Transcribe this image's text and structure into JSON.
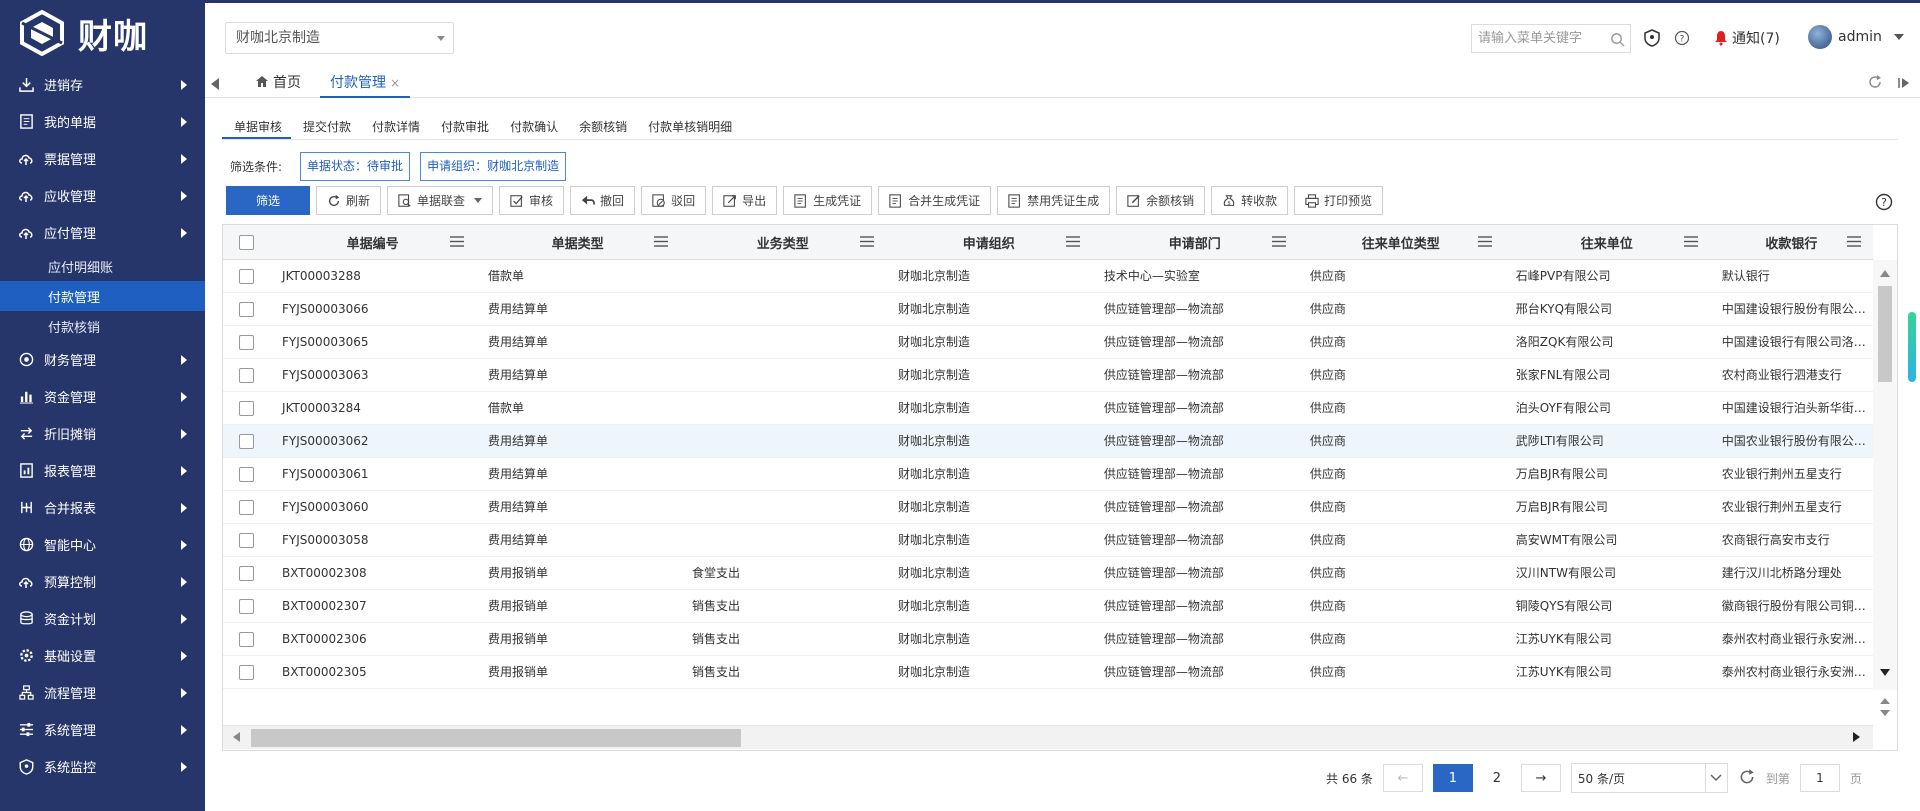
{
  "app": {
    "logo_text": "财咖",
    "org_selected": "财咖北京制造",
    "search_placeholder": "请输入菜单关键字",
    "notify_label": "通知(7)",
    "user_name": "admin"
  },
  "colors": {
    "sidebar": "#26366a",
    "accent": "#2a67c4",
    "active_sub": "#1f5fbf"
  },
  "sidebar": {
    "items": [
      {
        "label": "进销存",
        "icon": "download-icon"
      },
      {
        "label": "我的单据",
        "icon": "document-icon"
      },
      {
        "label": "票据管理",
        "icon": "cloud-upload-icon"
      },
      {
        "label": "应收管理",
        "icon": "cloud-upload-icon"
      },
      {
        "label": "应付管理",
        "icon": "cloud-upload-icon"
      },
      {
        "label": "财务管理",
        "icon": "finance-icon"
      },
      {
        "label": "资金管理",
        "icon": "bar-chart-icon"
      },
      {
        "label": "折旧摊销",
        "icon": "swap-icon"
      },
      {
        "label": "报表管理",
        "icon": "report-icon"
      },
      {
        "label": "合并报表",
        "icon": "merge-icon"
      },
      {
        "label": "智能中心",
        "icon": "globe-icon"
      },
      {
        "label": "预算控制",
        "icon": "cloud-upload-icon"
      },
      {
        "label": "资金计划",
        "icon": "database-icon"
      },
      {
        "label": "基础设置",
        "icon": "gear-icon"
      },
      {
        "label": "流程管理",
        "icon": "flow-icon"
      },
      {
        "label": "系统管理",
        "icon": "sliders-icon"
      },
      {
        "label": "系统监控",
        "icon": "shield-icon"
      }
    ],
    "subitems": [
      "应付明细账",
      "付款管理",
      "付款核销"
    ]
  },
  "tabs": {
    "home": "首页",
    "active": "付款管理",
    "close": "×"
  },
  "subtabs": [
    "单据审核",
    "提交付款",
    "付款详情",
    "付款审批",
    "付款确认",
    "余额核销",
    "付款单核销明细"
  ],
  "filters": {
    "label": "筛选条件:",
    "chips": [
      "单据状态：待审批",
      "申请组织：财咖北京制造"
    ]
  },
  "toolbar": {
    "filter": "筛选",
    "refresh": "刷新",
    "trace": "单据联查",
    "audit": "审核",
    "revoke": "撤回",
    "reject": "驳回",
    "export": "导出",
    "voucher": "生成凭证",
    "merge_voucher": "合并生成凭证",
    "disable_voucher": "禁用凭证生成",
    "balance_writeoff": "余额核销",
    "transfer": "转收款",
    "print_preview": "打印预览"
  },
  "table": {
    "columns": [
      "单据编号",
      "单据类型",
      "业务类型",
      "申请组织",
      "申请部门",
      "往来单位类型",
      "往来单位",
      "收款银行"
    ],
    "rows": [
      [
        "JKT00003288",
        "借款单",
        "",
        "财咖北京制造",
        "技术中心—实验室",
        "供应商",
        "石峰PVP有限公司",
        "默认银行"
      ],
      [
        "FYJS00003066",
        "费用结算单",
        "",
        "财咖北京制造",
        "供应链管理部—物流部",
        "供应商",
        "邢台KYQ有限公司",
        "中国建设银行股份有限公司..."
      ],
      [
        "FYJS00003065",
        "费用结算单",
        "",
        "财咖北京制造",
        "供应链管理部—物流部",
        "供应商",
        "洛阳ZQK有限公司",
        "中国建设银行有限公司洛阳..."
      ],
      [
        "FYJS00003063",
        "费用结算单",
        "",
        "财咖北京制造",
        "供应链管理部—物流部",
        "供应商",
        "张家FNL有限公司",
        "农村商业银行泗港支行"
      ],
      [
        "JKT00003284",
        "借款单",
        "",
        "财咖北京制造",
        "供应链管理部—物流部",
        "供应商",
        "泊头OYF有限公司",
        "中国建设银行泊头新华街支行"
      ],
      [
        "FYJS00003062",
        "费用结算单",
        "",
        "财咖北京制造",
        "供应链管理部—物流部",
        "供应商",
        "武陟LTI有限公司",
        "中国农业银行股份有限公司..."
      ],
      [
        "FYJS00003061",
        "费用结算单",
        "",
        "财咖北京制造",
        "供应链管理部—物流部",
        "供应商",
        "万启BJR有限公司",
        "农业银行荆州五星支行"
      ],
      [
        "FYJS00003060",
        "费用结算单",
        "",
        "财咖北京制造",
        "供应链管理部—物流部",
        "供应商",
        "万启BJR有限公司",
        "农业银行荆州五星支行"
      ],
      [
        "FYJS00003058",
        "费用结算单",
        "",
        "财咖北京制造",
        "供应链管理部—物流部",
        "供应商",
        "高安WMT有限公司",
        "农商银行高安市支行"
      ],
      [
        "BXT00002308",
        "费用报销单",
        "食堂支出",
        "财咖北京制造",
        "供应链管理部—物流部",
        "供应商",
        "汉川NTW有限公司",
        "建行汉川北桥路分理处"
      ],
      [
        "BXT00002307",
        "费用报销单",
        "销售支出",
        "财咖北京制造",
        "供应链管理部—物流部",
        "供应商",
        "铜陵QYS有限公司",
        "徽商银行股份有限公司铜陵..."
      ],
      [
        "BXT00002306",
        "费用报销单",
        "销售支出",
        "财咖北京制造",
        "供应链管理部—物流部",
        "供应商",
        "江苏UYK有限公司",
        "泰州农村商业银行永安洲支行"
      ],
      [
        "BXT00002305",
        "费用报销单",
        "销售支出",
        "财咖北京制造",
        "供应链管理部—物流部",
        "供应商",
        "江苏UYK有限公司",
        "泰州农村商业银行永安洲支行"
      ]
    ]
  },
  "pager": {
    "total": "共 66 条",
    "prev": "←",
    "page1": "1",
    "page2": "2",
    "next": "→",
    "page_size": "50 条/页",
    "goto_label": "到第",
    "goto_value": "1",
    "page_unit": "页"
  }
}
